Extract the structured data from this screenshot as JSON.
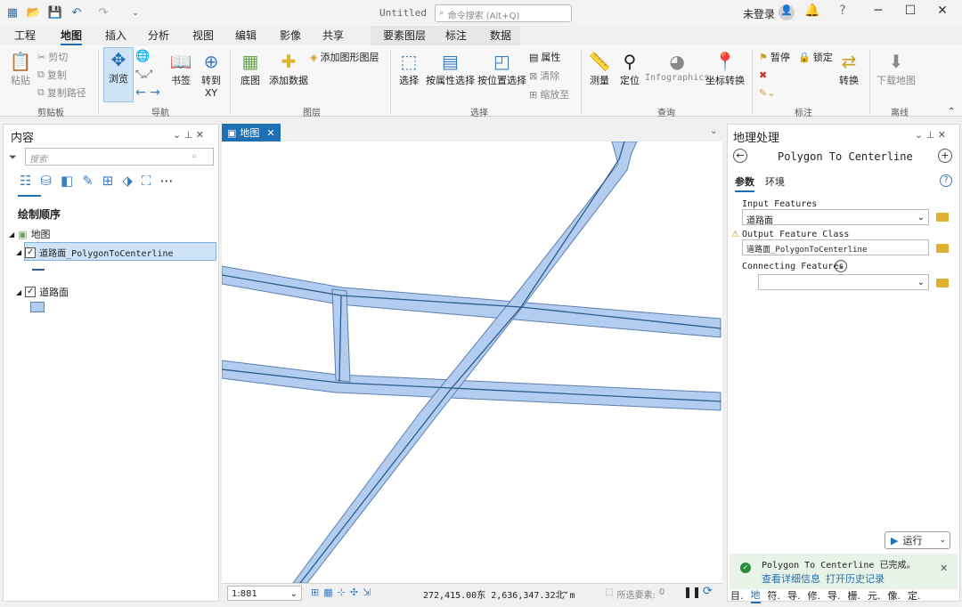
{
  "window": {
    "title": "Untitled",
    "search_placeholder": "命令搜索 (Alt+Q)",
    "user": "未登录",
    "min": "─",
    "max": "☐",
    "close": "✕",
    "bell": "🔔",
    "help": "?"
  },
  "tabs": [
    "工程",
    "地图",
    "插入",
    "分析",
    "视图",
    "编辑",
    "影像",
    "共享",
    "要素图层",
    "标注",
    "数据"
  ],
  "ribbon": {
    "clipboard": {
      "paste": "粘贴",
      "cut": "剪切",
      "copy": "复制",
      "copy_path": "复制路径",
      "group": "剪贴板"
    },
    "navigate": {
      "explore": "浏览",
      "bookmarks": "书签",
      "goto": "转到\nXY",
      "group": "导航"
    },
    "layer": {
      "basemap": "底图",
      "add_data": "添加数据",
      "add_graphics": "添加图形图层",
      "group": "图层"
    },
    "selection": {
      "select": "选择",
      "by_attr": "按属性选择",
      "by_loc": "按位置选择",
      "attributes": "属性",
      "clear": "清除",
      "zoom_to": "缩放至",
      "group": "选择"
    },
    "inquiry": {
      "measure": "测量",
      "locate": "定位",
      "infographics": "Infographics",
      "coord": "坐标转换",
      "group": "查询"
    },
    "labeling": {
      "pause": "暂停",
      "lock": "锁定",
      "convert": "转换",
      "group": "标注"
    },
    "offline": {
      "download": "下载地图",
      "group": "离线"
    }
  },
  "contents": {
    "title": "内容",
    "search_placeholder": "搜索",
    "draw_order": "绘制顺序",
    "map": "地图",
    "layer1": "道路面_PolygonToCenterline",
    "layer2": "道路面"
  },
  "map": {
    "tab": "地图",
    "scale": "1:881",
    "coords": "272,415.00东 2,636,347.32北 m",
    "selected": "所选要素:",
    "selected_count": "0"
  },
  "geo": {
    "title": "地理处理",
    "tool": "Polygon To Centerline",
    "tab_params": "参数",
    "tab_env": "环境",
    "input_label": "Input Features",
    "input_value": "道路面",
    "output_label": "Output Feature Class",
    "output_value": "道路面_PolygonToCenterline",
    "connect_label": "Connecting Features",
    "run": "运行",
    "msg": "Polygon To Centerline 已完成。",
    "details": "查看详细信息",
    "history": "打开历史记录"
  },
  "bottom_tabs": [
    "目.",
    "地",
    "符.",
    "导.",
    "修.",
    "导.",
    "栅.",
    "元.",
    "像.",
    "定."
  ],
  "colors": {
    "road_fill": "#b3cdf0",
    "road_edge": "#5b7fb0",
    "centerline": "#2b5c8a",
    "accent": "#1f6fb5",
    "success": "#e8f3e8"
  }
}
